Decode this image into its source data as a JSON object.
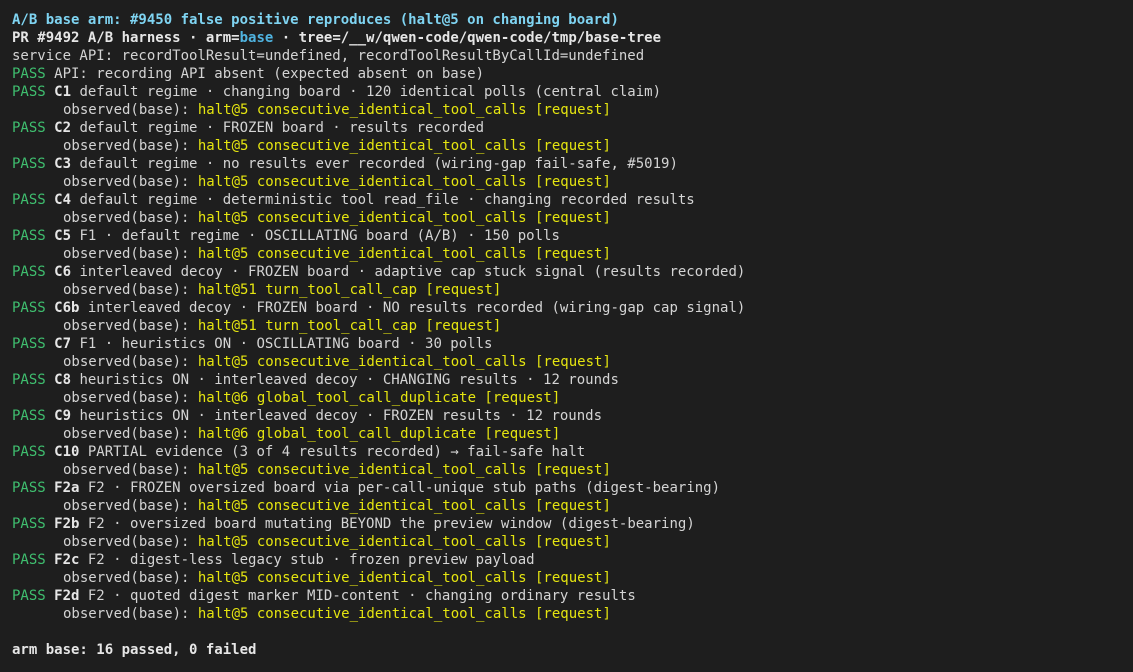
{
  "title": "A/B base arm: #9450 false positive reproduces (halt@5 on changing board)",
  "header": {
    "pr": "PR #9492 A/B harness",
    "sep1": " · ",
    "arm_key": "arm=",
    "arm_value": "base",
    "sep2": " · ",
    "tree": "tree=/__w/qwen-code/qwen-code/tmp/base-tree"
  },
  "service_api": "service API: recordToolResult=undefined, recordToolResultByCallId=undefined",
  "api_check": {
    "status": "PASS",
    "text": " API: recording API absent (expected absent on base)"
  },
  "observed_label": "observed(base): ",
  "cases": [
    {
      "status": "PASS",
      "id": "C1",
      "desc": " default regime · changing board · 120 identical polls (central claim)",
      "observed": "halt@5 consecutive_identical_tool_calls [request]"
    },
    {
      "status": "PASS",
      "id": "C2",
      "desc": " default regime · FROZEN board · results recorded",
      "observed": "halt@5 consecutive_identical_tool_calls [request]"
    },
    {
      "status": "PASS",
      "id": "C3",
      "desc": " default regime · no results ever recorded (wiring-gap fail-safe, #5019)",
      "observed": "halt@5 consecutive_identical_tool_calls [request]"
    },
    {
      "status": "PASS",
      "id": "C4",
      "desc": " default regime · deterministic tool read_file · changing recorded results",
      "observed": "halt@5 consecutive_identical_tool_calls [request]"
    },
    {
      "status": "PASS",
      "id": "C5",
      "desc": " F1 · default regime · OSCILLATING board (A/B) · 150 polls",
      "observed": "halt@5 consecutive_identical_tool_calls [request]"
    },
    {
      "status": "PASS",
      "id": "C6",
      "desc": " interleaved decoy · FROZEN board · adaptive cap stuck signal (results recorded)",
      "observed": "halt@51 turn_tool_call_cap [request]"
    },
    {
      "status": "PASS",
      "id": "C6b",
      "desc": " interleaved decoy · FROZEN board · NO results recorded (wiring-gap cap signal)",
      "observed": "halt@51 turn_tool_call_cap [request]"
    },
    {
      "status": "PASS",
      "id": "C7",
      "desc": " F1 · heuristics ON · OSCILLATING board · 30 polls",
      "observed": "halt@5 consecutive_identical_tool_calls [request]"
    },
    {
      "status": "PASS",
      "id": "C8",
      "desc": " heuristics ON · interleaved decoy · CHANGING results · 12 rounds",
      "observed": "halt@6 global_tool_call_duplicate [request]"
    },
    {
      "status": "PASS",
      "id": "C9",
      "desc": " heuristics ON · interleaved decoy · FROZEN results · 12 rounds",
      "observed": "halt@6 global_tool_call_duplicate [request]"
    },
    {
      "status": "PASS",
      "id": "C10",
      "desc": " PARTIAL evidence (3 of 4 results recorded) → fail-safe halt",
      "observed": "halt@5 consecutive_identical_tool_calls [request]"
    },
    {
      "status": "PASS",
      "id": "F2a",
      "desc": " F2 · FROZEN oversized board via per-call-unique stub paths (digest-bearing)",
      "observed": "halt@5 consecutive_identical_tool_calls [request]"
    },
    {
      "status": "PASS",
      "id": "F2b",
      "desc": " F2 · oversized board mutating BEYOND the preview window (digest-bearing)",
      "observed": "halt@5 consecutive_identical_tool_calls [request]"
    },
    {
      "status": "PASS",
      "id": "F2c",
      "desc": " F2 · digest-less legacy stub · frozen preview payload",
      "observed": "halt@5 consecutive_identical_tool_calls [request]"
    },
    {
      "status": "PASS",
      "id": "F2d",
      "desc": " F2 · quoted digest marker MID-content · changing ordinary results",
      "observed": "halt@5 consecutive_identical_tool_calls [request]"
    }
  ],
  "summary": "arm base: 16 passed, 0 failed",
  "colors": {
    "background": "#1e1e1e",
    "pass": "#3fbf6f",
    "observed": "#e5e510",
    "title": "#7fd4f2",
    "arm": "#4fb3e0"
  }
}
